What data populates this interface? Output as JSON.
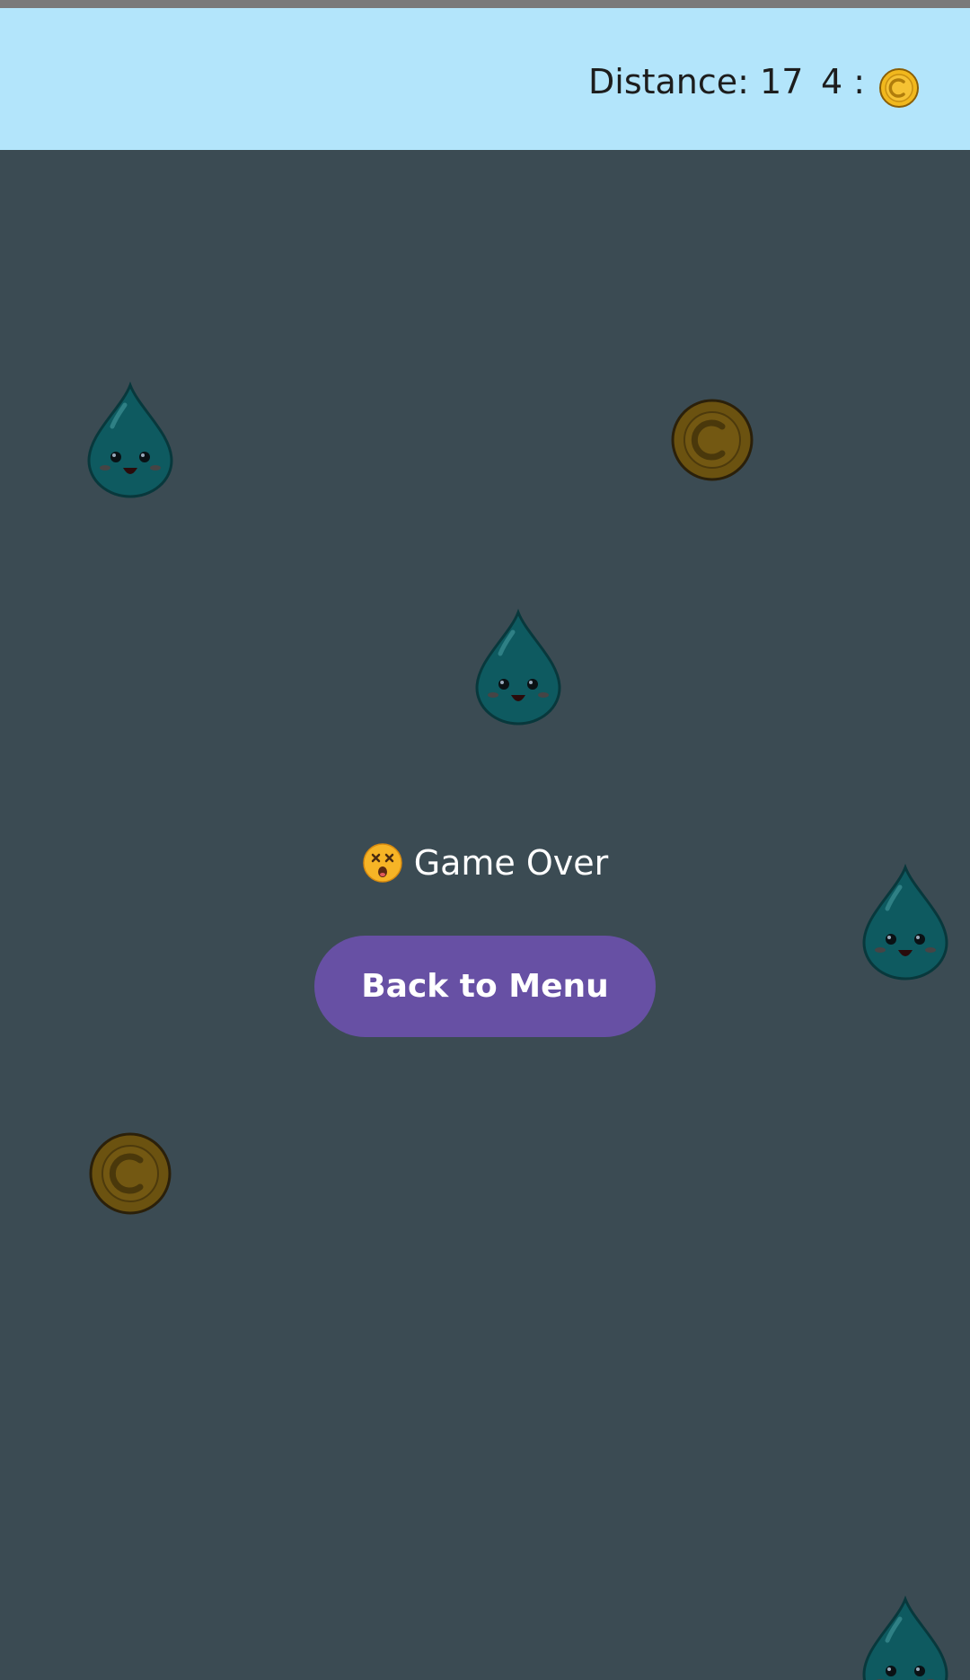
{
  "hud": {
    "distance_text": "Distance: 17",
    "coins_text": "4 :",
    "coin_icon": "coin-icon"
  },
  "game_over": {
    "emoji": "dizzy-face-icon",
    "text": "Game Over",
    "button_label": "Back to Menu"
  },
  "colors": {
    "hud_background": "#b3e5fb",
    "playfield_background": "#3b4b53",
    "button_background": "#6750a4",
    "drop_color": "#0e5a60",
    "coin_dim_color": "#6b5210",
    "coin_bright_color": "#f1b81d"
  },
  "playfield": {
    "drops": [
      "water-drop-character",
      "water-drop-character",
      "water-drop-character",
      "water-drop-character"
    ],
    "coins": [
      "coin",
      "coin"
    ]
  }
}
